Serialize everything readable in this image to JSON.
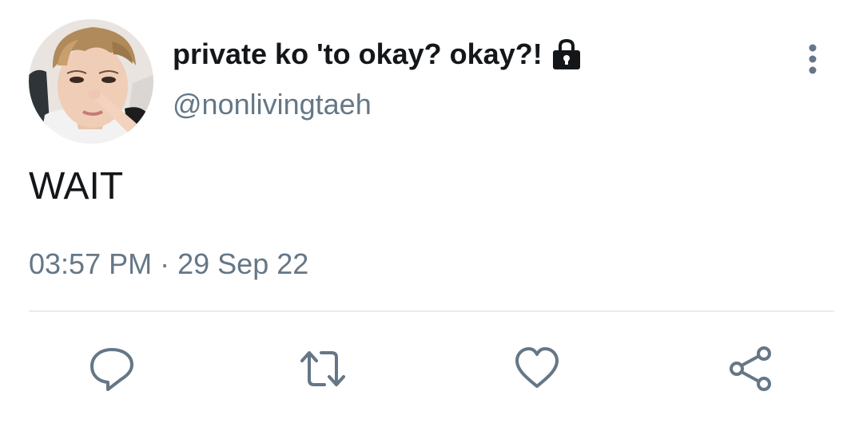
{
  "tweet": {
    "author": {
      "display_name": "private ko 'to okay? okay?!",
      "handle": "@nonlivingtaeh",
      "protected_icon": "lock-icon",
      "avatar": "profile-photo"
    },
    "text": "WAIT",
    "time": "03:57 PM",
    "separator": "·",
    "date": "29 Sep 22",
    "menu_icon": "more-vertical-icon",
    "actions": [
      {
        "name": "reply",
        "icon": "reply-icon"
      },
      {
        "name": "retweet",
        "icon": "retweet-icon"
      },
      {
        "name": "like",
        "icon": "heart-icon"
      },
      {
        "name": "share",
        "icon": "share-icon"
      }
    ]
  },
  "colors": {
    "text_primary": "#14171a",
    "text_secondary": "#657786",
    "divider": "#e6ecf0",
    "icon": "#657786"
  }
}
